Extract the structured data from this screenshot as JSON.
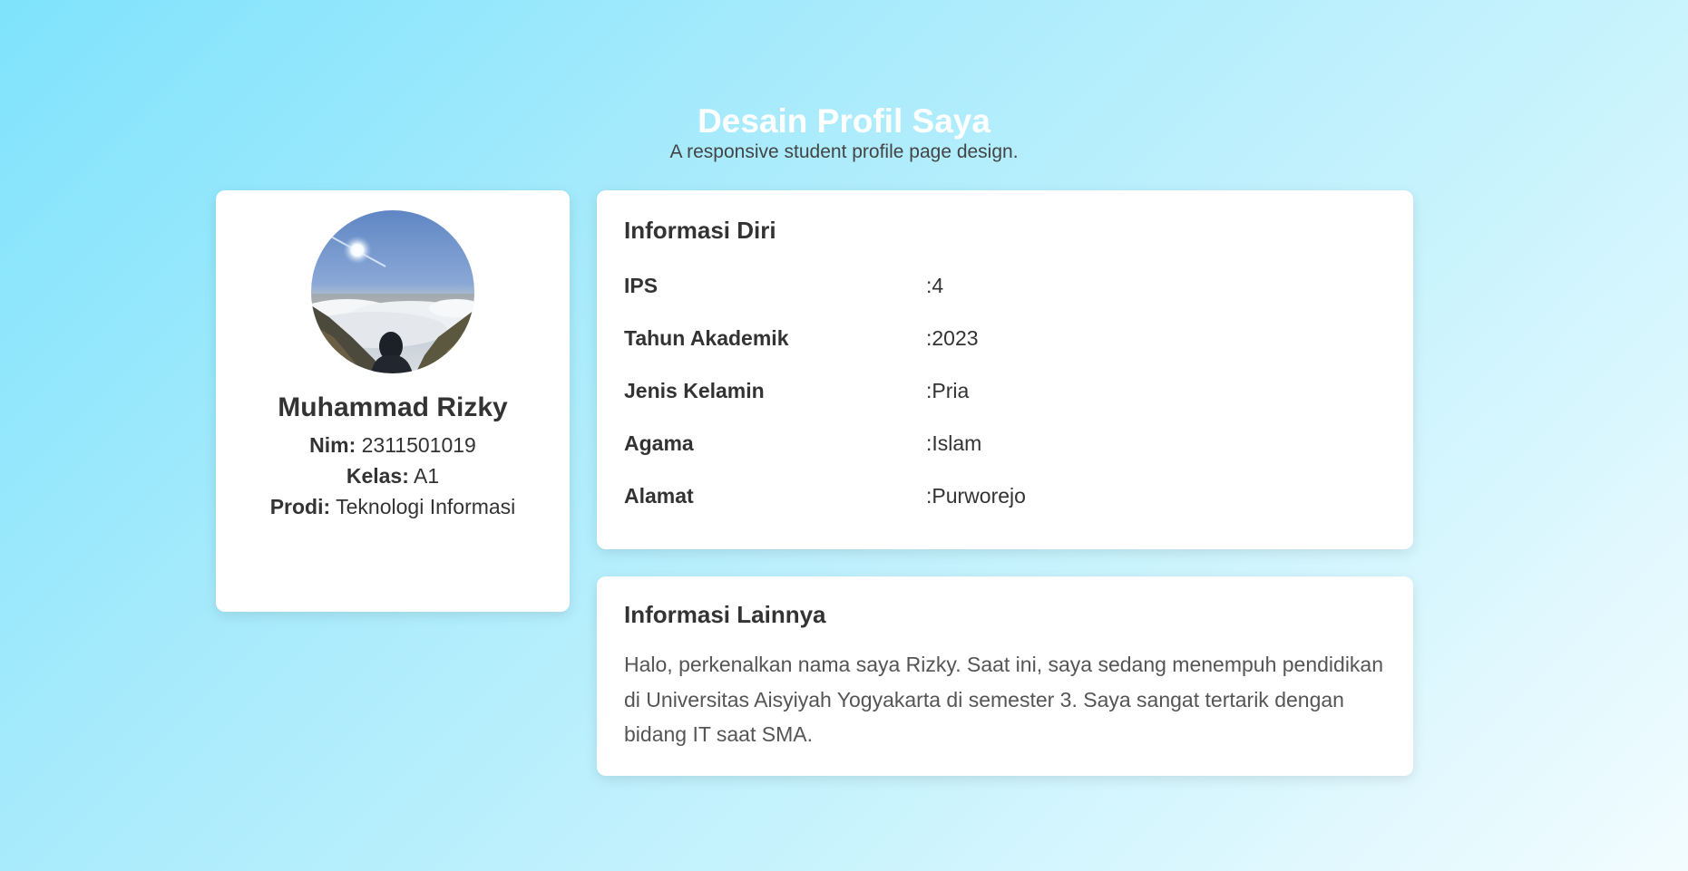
{
  "header": {
    "title": "Desain Profil Saya",
    "subtitle": "A responsive student profile page design."
  },
  "profile": {
    "name": "Muhammad Rizky",
    "nim_label": "Nim:",
    "nim": "2311501019",
    "kelas_label": "Kelas:",
    "kelas": "A1",
    "prodi_label": "Prodi:",
    "prodi": "Teknologi Informasi"
  },
  "info": {
    "title": "Informasi Diri",
    "rows": [
      {
        "key": "IPS",
        "value": ":4"
      },
      {
        "key": "Tahun Akademik",
        "value": ":2023"
      },
      {
        "key": "Jenis Kelamin",
        "value": ":Pria"
      },
      {
        "key": "Agama",
        "value": ":Islam"
      },
      {
        "key": "Alamat",
        "value": ":Purworejo"
      }
    ]
  },
  "other": {
    "title": "Informasi Lainnya",
    "text": "Halo, perkenalkan nama saya Rizky. Saat ini, saya sedang menempuh pendidikan di Universitas Aisyiyah Yogyakarta di semester 3. Saya sangat tertarik dengan bidang IT saat SMA."
  },
  "colors": {
    "background_start": "#7fe3fc",
    "background_end": "#f2fcff",
    "card": "#ffffff",
    "title": "#ffffff",
    "text": "#333333"
  }
}
